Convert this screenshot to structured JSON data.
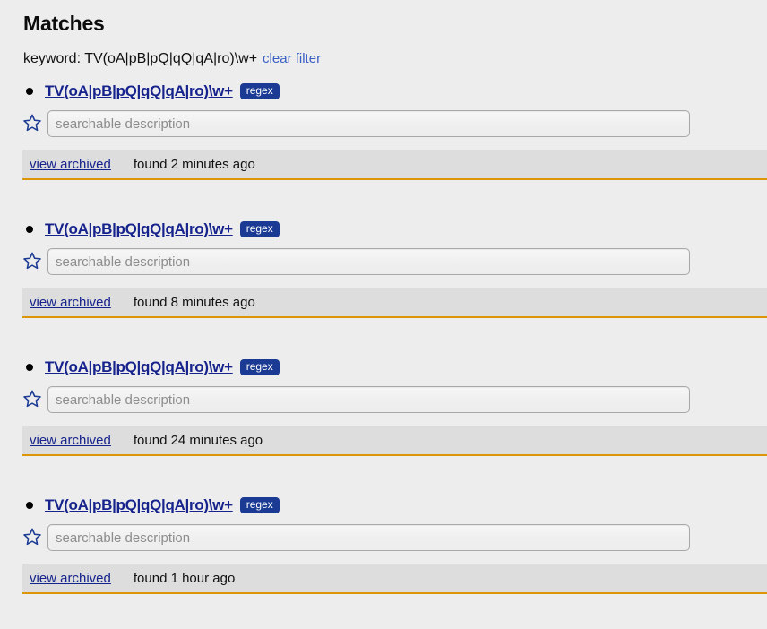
{
  "header": {
    "title": "Matches",
    "filter_label": "keyword:",
    "filter_value": "TV(oA|pB|pQ|qQ|qA|ro)\\w+",
    "clear_filter_label": "clear filter"
  },
  "colors": {
    "page_background": "#ededed",
    "link": "#16238c",
    "clear_filter_link": "#3a5fc4",
    "badge_background": "#1b3a94",
    "badge_text": "#ffffff",
    "footer_background": "#dddddd",
    "footer_accent_border": "#dd9508",
    "star_icon": "#1b3a94"
  },
  "icons": {
    "bullet": "bullet-dot",
    "star": "star-outline-icon"
  },
  "input": {
    "placeholder": "searchable description",
    "value": ""
  },
  "labels": {
    "badge_regex": "regex",
    "view_archived": "view archived"
  },
  "results": [
    {
      "title": "TV(oA|pB|pQ|qQ|qA|ro)\\w+",
      "badge": "regex",
      "description_placeholder": "searchable description",
      "description_value": "",
      "view_archived": "view archived",
      "found_time": "found 2 minutes ago"
    },
    {
      "title": "TV(oA|pB|pQ|qQ|qA|ro)\\w+",
      "badge": "regex",
      "description_placeholder": "searchable description",
      "description_value": "",
      "view_archived": "view archived",
      "found_time": "found 8 minutes ago"
    },
    {
      "title": "TV(oA|pB|pQ|qQ|qA|ro)\\w+",
      "badge": "regex",
      "description_placeholder": "searchable description",
      "description_value": "",
      "view_archived": "view archived",
      "found_time": "found 24 minutes ago"
    },
    {
      "title": "TV(oA|pB|pQ|qQ|qA|ro)\\w+",
      "badge": "regex",
      "description_placeholder": "searchable description",
      "description_value": "",
      "view_archived": "view archived",
      "found_time": "found 1 hour ago"
    }
  ]
}
